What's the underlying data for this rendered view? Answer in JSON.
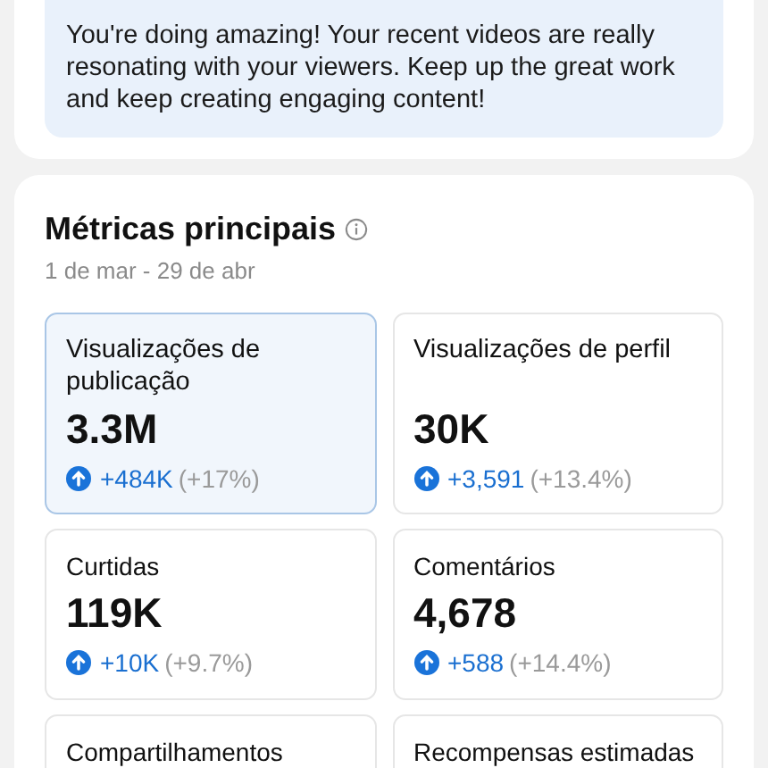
{
  "message": "You're doing amazing! Your recent videos are really resonating with your viewers. Keep up the great work and keep creating engaging content!",
  "metrics_section": {
    "title": "Métricas principais",
    "date_range": "1 de mar - 29 de abr",
    "cards": [
      {
        "label": "Visualizações de publicação",
        "value": "3.3M",
        "change": "+484K",
        "percent": "(+17%)",
        "selected": true
      },
      {
        "label": "Visualizações de perfil",
        "value": "30K",
        "change": "+3,591",
        "percent": "(+13.4%)",
        "selected": false
      },
      {
        "label": "Curtidas",
        "value": "119K",
        "change": "+10K",
        "percent": "(+9.7%)",
        "selected": false
      },
      {
        "label": "Comentários",
        "value": "4,678",
        "change": "+588",
        "percent": "(+14.4%)",
        "selected": false
      },
      {
        "label": "Compartilhamentos",
        "selected": false
      },
      {
        "label": "Recompensas estimadas",
        "selected": false
      }
    ]
  }
}
